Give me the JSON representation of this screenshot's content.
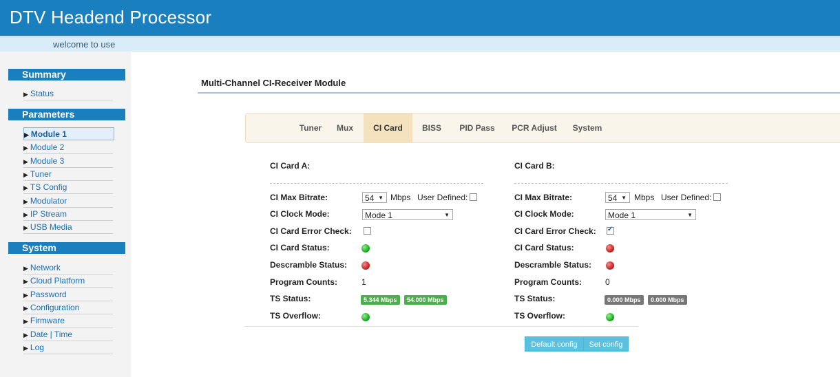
{
  "header": {
    "title": "DTV Headend Processor"
  },
  "welcome": "welcome to use",
  "sidebar": {
    "sections": [
      {
        "title": "Summary",
        "items": [
          "Status"
        ]
      },
      {
        "title": "Parameters",
        "items": [
          "Module 1",
          "Module 2",
          "Module 3",
          "Tuner",
          "TS Config",
          "Modulator",
          "IP Stream",
          "USB Media"
        ]
      },
      {
        "title": "System",
        "items": [
          "Network",
          "Cloud Platform",
          "Password",
          "Configuration",
          "Firmware",
          "Date | Time",
          "Log"
        ]
      }
    ],
    "active_item": "Module 1"
  },
  "main": {
    "title": "Multi-Channel CI-Receiver Module",
    "tabs": [
      "Tuner",
      "Mux",
      "CI Card",
      "BISS",
      "PID Pass",
      "PCR Adjust",
      "System"
    ],
    "active_tab": "CI Card",
    "labels": {
      "max_bitrate": "CI Max Bitrate:",
      "mbps": "Mbps",
      "user_defined": "User Defined:",
      "clock_mode": "CI Clock Mode:",
      "error_check": "CI Card Error Check:",
      "card_status": "CI Card Status:",
      "descramble_status": "Descramble Status:",
      "program_counts": "Program Counts:",
      "ts_status": "TS Status:",
      "ts_overflow": "TS Overflow:"
    },
    "card_a": {
      "title": "CI Card A:",
      "max_bitrate": "54",
      "user_defined": false,
      "clock_mode": "Mode 1",
      "error_check": false,
      "card_status": "green",
      "descramble_status": "red",
      "program_counts": "1",
      "ts_status": [
        "5.344 Mbps",
        "54.000 Mbps"
      ],
      "ts_status_color": "green",
      "ts_overflow": "green"
    },
    "card_b": {
      "title": "CI Card B:",
      "max_bitrate": "54",
      "user_defined": false,
      "clock_mode": "Mode 1",
      "error_check": true,
      "card_status": "red",
      "descramble_status": "red",
      "program_counts": "0",
      "ts_status": [
        "0.000 Mbps",
        "0.000 Mbps"
      ],
      "ts_status_color": "gray",
      "ts_overflow": "green"
    },
    "buttons": {
      "default": "Default config",
      "set": "Set config"
    }
  },
  "colors": {
    "header": "#1a7fbf",
    "active_tab": "#f3e2bd",
    "button": "#5bc0de"
  }
}
